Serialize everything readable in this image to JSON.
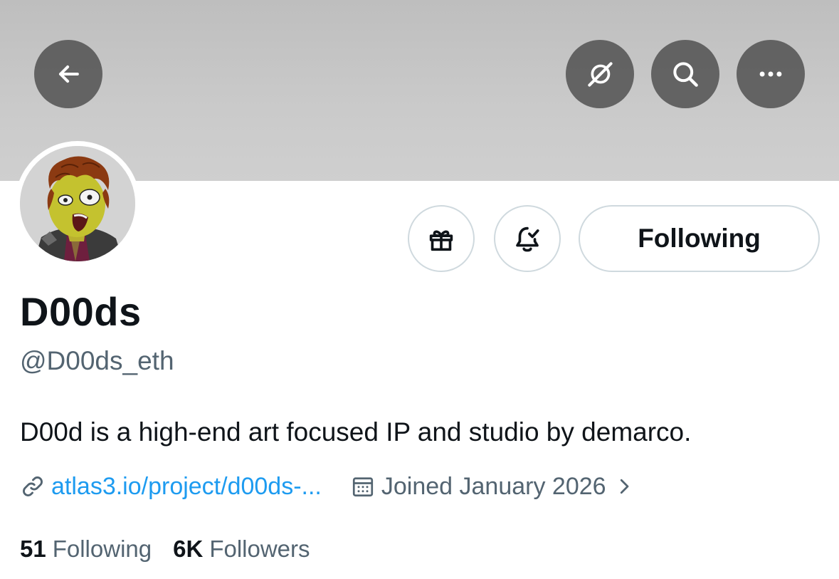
{
  "header": {
    "icons": {
      "back": "arrow-left-icon",
      "grok": "grok-icon",
      "search": "search-icon",
      "more": "more-horizontal-icon"
    }
  },
  "actions": {
    "gift_icon": "gift-icon",
    "notify_icon": "bell-check-icon",
    "follow_label": "Following"
  },
  "profile": {
    "display_name": "D00ds",
    "handle": "@D00ds_eth",
    "bio": "D00d is a high-end art focused IP and studio by demarco.",
    "link": "atlas3.io/project/d00ds-...",
    "joined": "Joined January 2026"
  },
  "stats": {
    "following_count": "51",
    "following_label": "Following",
    "followers_count": "6K",
    "followers_label": "Followers"
  },
  "colors": {
    "accent": "#1d9bf0",
    "text_primary": "#0f1419",
    "text_secondary": "#536471",
    "border": "#cfd9de"
  }
}
